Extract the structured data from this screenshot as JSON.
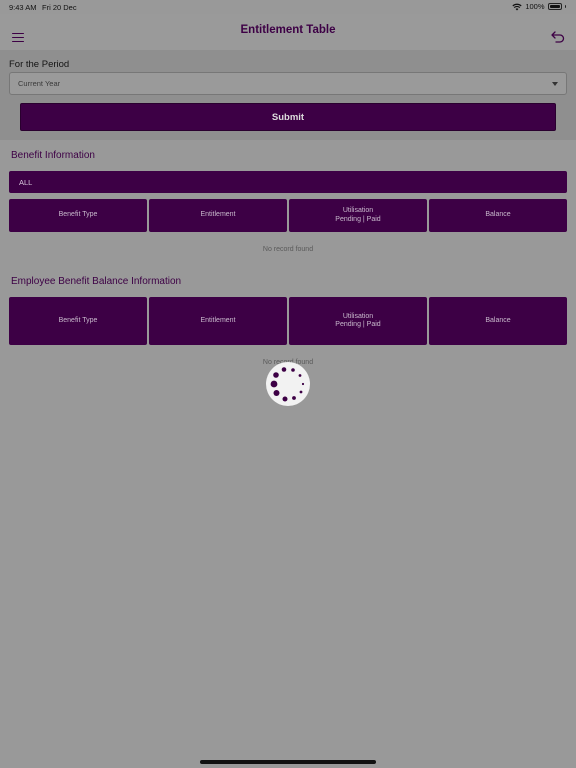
{
  "status_bar": {
    "time": "9:43 AM",
    "date": "Fri 20 Dec",
    "battery": "100%"
  },
  "nav": {
    "title": "Entitlement Table",
    "menu_icon": "hamburger-menu-icon",
    "back_icon": "undo-arrow-icon"
  },
  "period": {
    "label": "For the Period",
    "selected": "Current Year",
    "submit_label": "Submit"
  },
  "benefit_info": {
    "title": "Benefit Information",
    "filter": "ALL",
    "headers": [
      {
        "line1": "Benefit Type",
        "line2": ""
      },
      {
        "line1": "Entitlement",
        "line2": ""
      },
      {
        "line1": "Utilisation",
        "line2": "Pending | Paid"
      },
      {
        "line1": "Balance",
        "line2": ""
      }
    ],
    "empty_text": "No record found"
  },
  "employee_balance": {
    "title": "Employee Benefit Balance Information",
    "headers": [
      {
        "line1": "Benefit Type",
        "line2": ""
      },
      {
        "line1": "Entitlement",
        "line2": ""
      },
      {
        "line1": "Utilisation",
        "line2": "Pending | Paid"
      },
      {
        "line1": "Balance",
        "line2": ""
      }
    ],
    "empty_text": "No record found"
  },
  "colors": {
    "primary": "#3d0045",
    "overlay_bg": "#999999"
  }
}
